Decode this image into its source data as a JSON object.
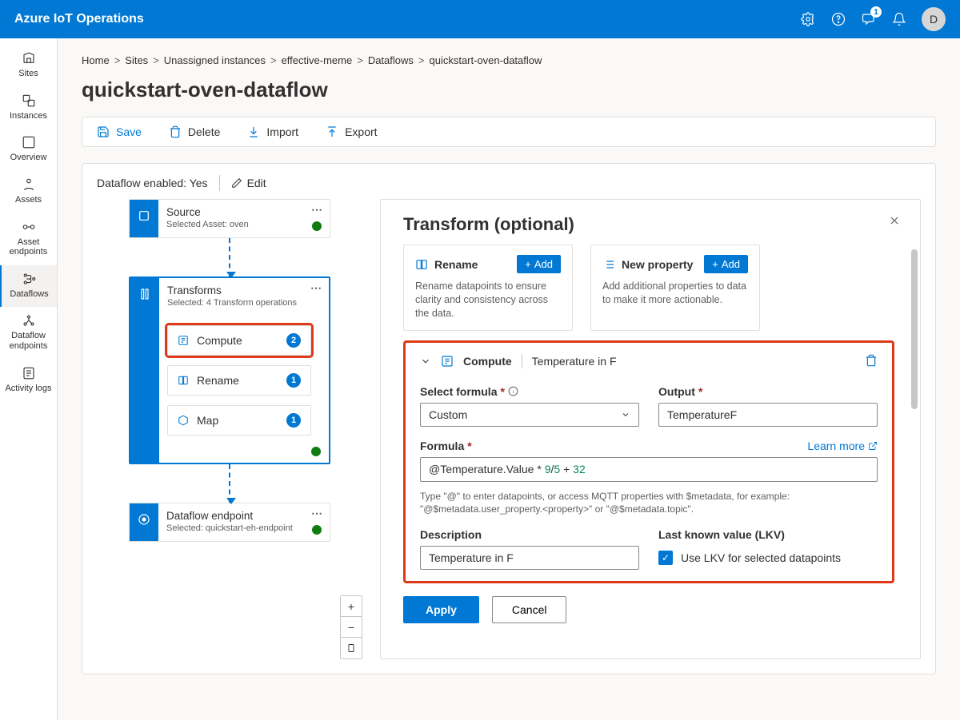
{
  "header": {
    "app_title": "Azure IoT Operations",
    "avatar_initial": "D",
    "feedback_badge": "1"
  },
  "sidebar": {
    "items": [
      {
        "label": "Sites"
      },
      {
        "label": "Instances"
      },
      {
        "label": "Overview"
      },
      {
        "label": "Assets"
      },
      {
        "label": "Asset endpoints"
      },
      {
        "label": "Dataflows"
      },
      {
        "label": "Dataflow endpoints"
      },
      {
        "label": "Activity logs"
      }
    ]
  },
  "breadcrumb": [
    "Home",
    "Sites",
    "Unassigned instances",
    "effective-meme",
    "Dataflows",
    "quickstart-oven-dataflow"
  ],
  "page_title": "quickstart-oven-dataflow",
  "toolbar": {
    "save": "Save",
    "delete": "Delete",
    "import": "Import",
    "export": "Export"
  },
  "df_header": {
    "enabled_label": "Dataflow enabled: Yes",
    "edit_label": "Edit"
  },
  "graph": {
    "source": {
      "title": "Source",
      "sub": "Selected Asset: oven"
    },
    "transforms": {
      "title": "Transforms",
      "sub": "Selected: 4 Transform operations",
      "items": [
        {
          "label": "Compute",
          "count": "2"
        },
        {
          "label": "Rename",
          "count": "1"
        },
        {
          "label": "Map",
          "count": "1"
        }
      ]
    },
    "endpoint": {
      "title": "Dataflow endpoint",
      "sub": "Selected: quickstart-eh-endpoint"
    }
  },
  "panel": {
    "title": "Transform (optional)",
    "rename_card": {
      "title": "Rename",
      "add": "Add",
      "desc": "Rename datapoints to ensure clarity and consistency across the data."
    },
    "newprop_card": {
      "title": "New property",
      "add": "Add",
      "desc": "Add additional properties to data to make it more actionable."
    },
    "compute": {
      "head_label": "Compute",
      "head_name": "Temperature in F",
      "select_formula_label": "Select formula",
      "select_formula_value": "Custom",
      "output_label": "Output",
      "output_value": "TemperatureF",
      "formula_label": "Formula",
      "formula_prefix": "@Temperature.Value ",
      "formula_help": "Type \"@\" to enter datapoints, or access MQTT properties with $metadata, for example: \"@$metadata.user_property.<property>\" or \"@$metadata.topic\".",
      "learn_more": "Learn more",
      "desc_label": "Description",
      "desc_value": "Temperature in F",
      "lkv_label": "Last known value (LKV)",
      "lkv_check": "Use LKV for selected datapoints"
    },
    "apply": "Apply",
    "cancel": "Cancel"
  }
}
